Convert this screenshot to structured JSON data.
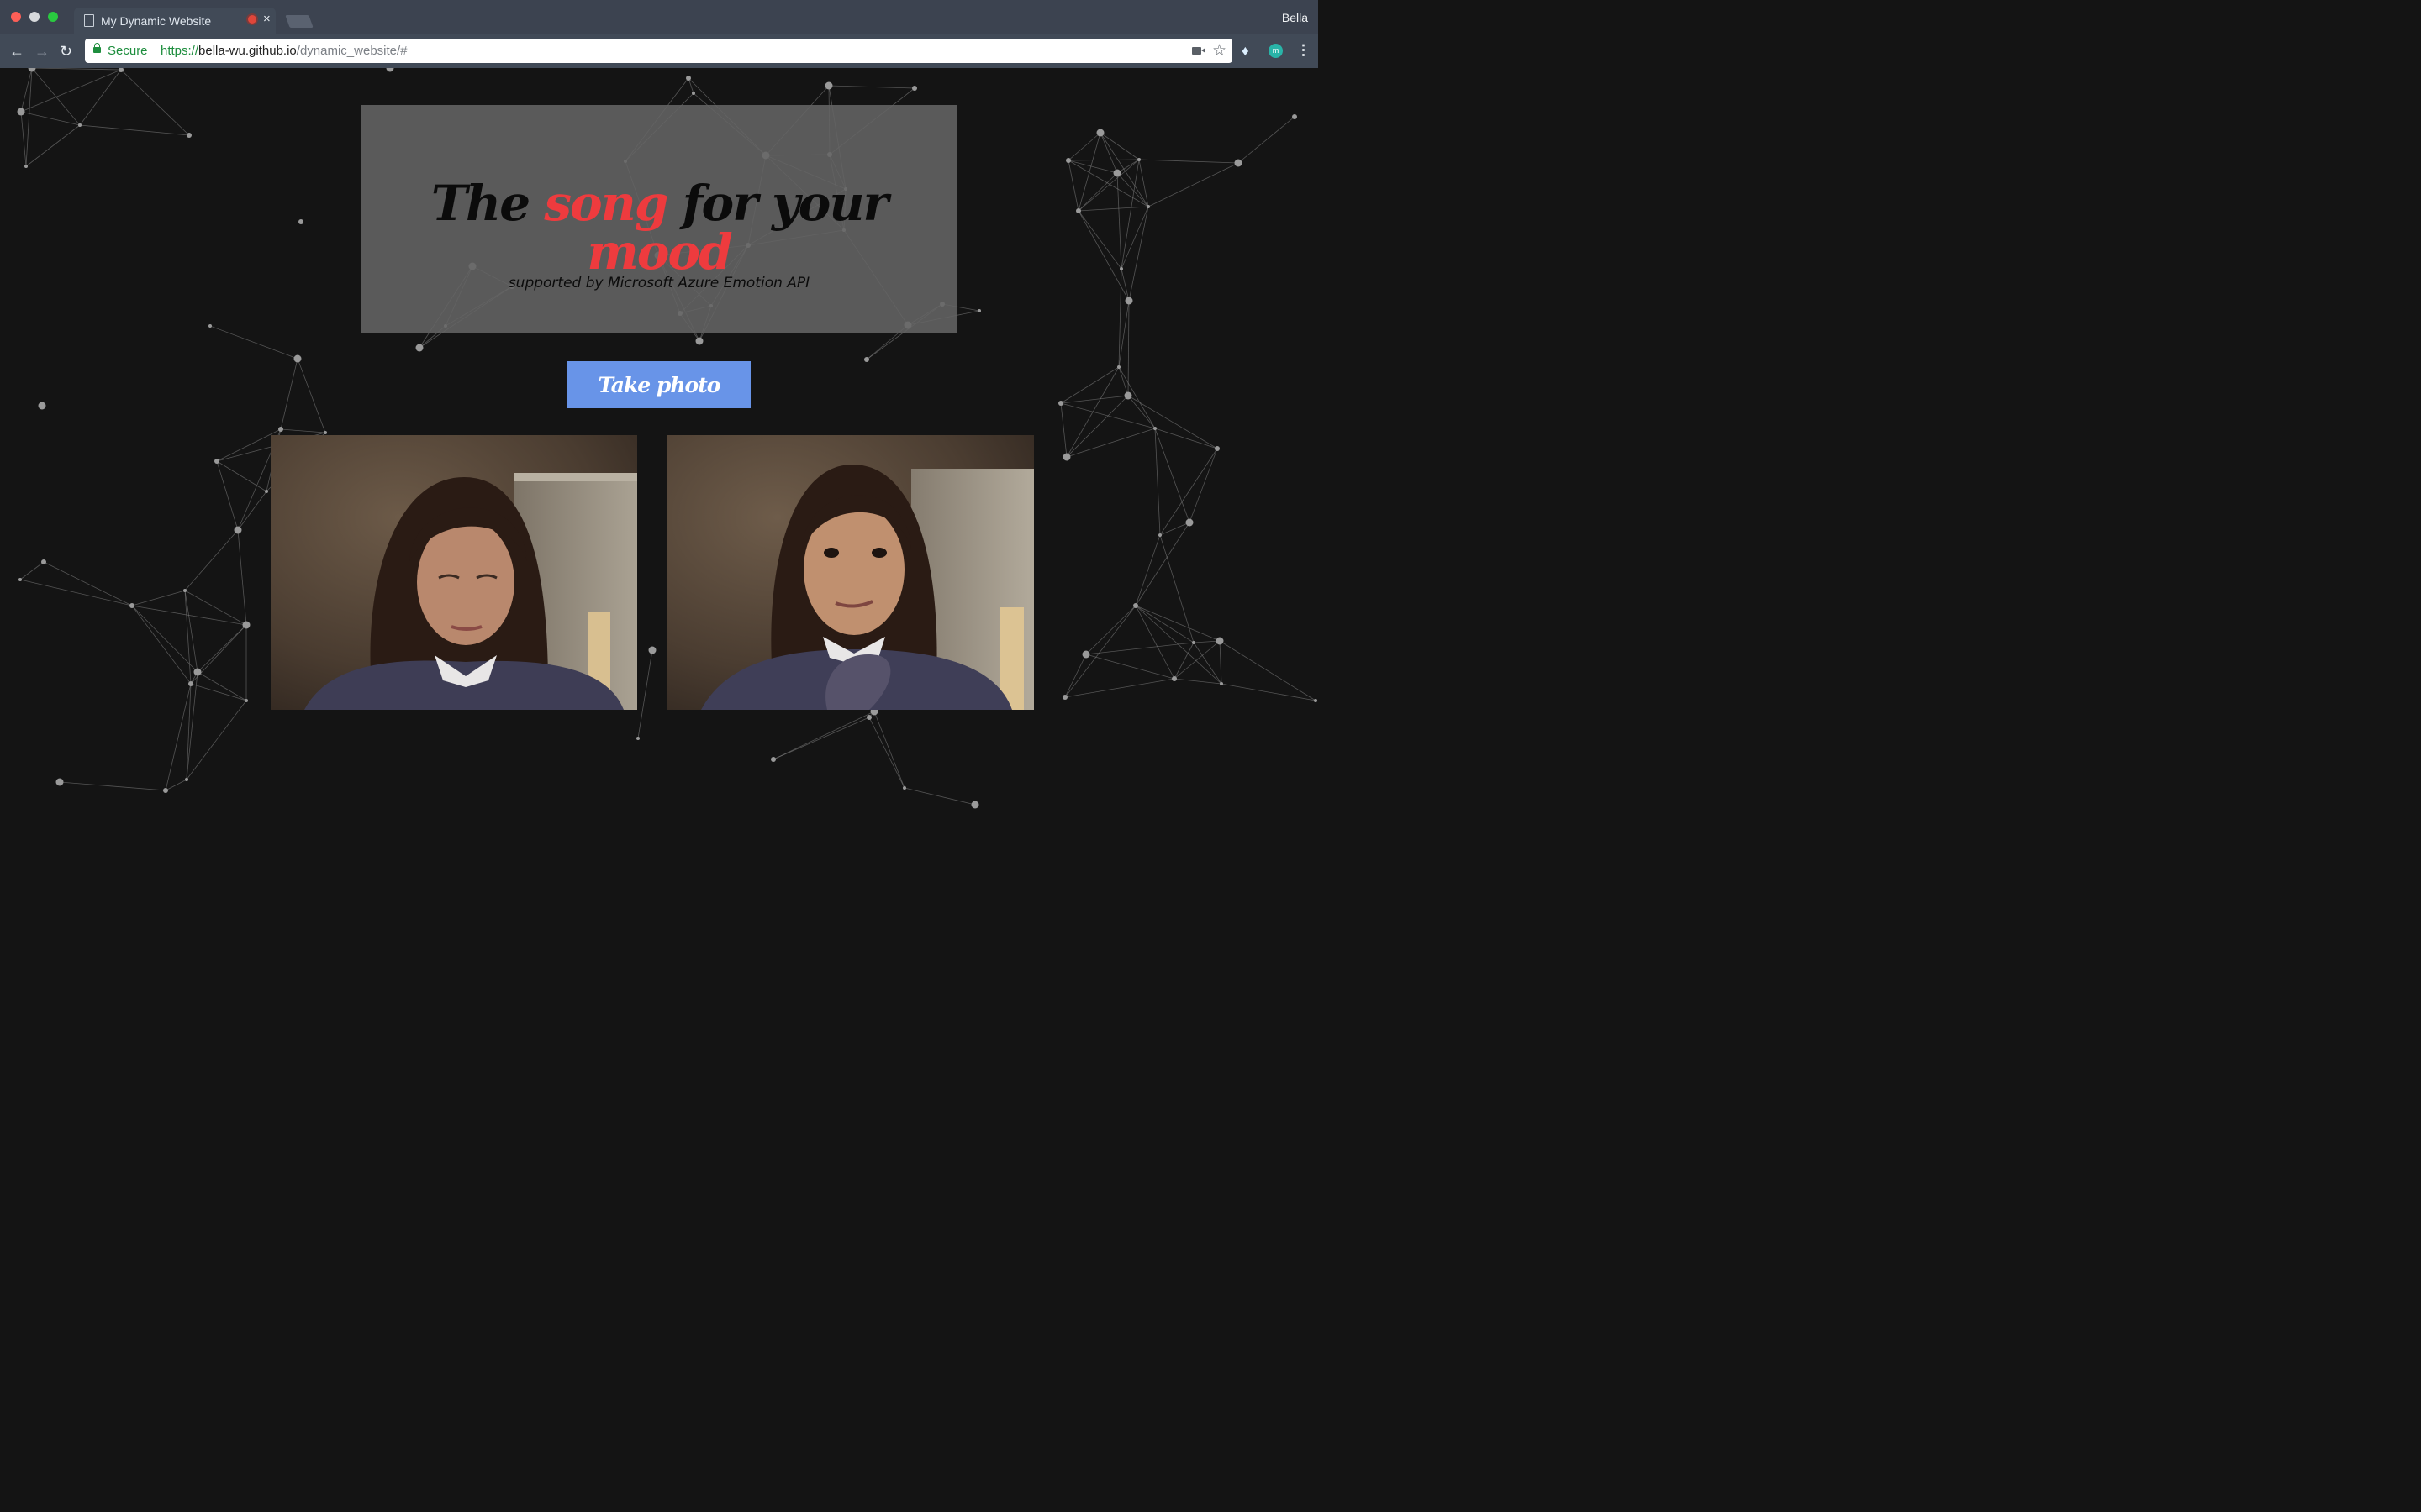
{
  "browser": {
    "tab_title": "My Dynamic Website",
    "tab_close": "×",
    "profile_name": "Bella",
    "secure_label": "Secure",
    "url_scheme": "https://",
    "url_host": "bella-wu.github.io",
    "url_path": "/dynamic_website/#",
    "ext_grammarly_letter": "m"
  },
  "hero": {
    "title_parts": [
      "The ",
      "song",
      " for your ",
      "mood"
    ],
    "subtitle": "supported by Microsoft Azure Emotion API"
  },
  "actions": {
    "take_photo_label": "Take photo"
  },
  "colors": {
    "accent_red": "#ee3b3e",
    "button_blue": "#6894e8",
    "page_bg": "#141414"
  },
  "icons": [
    "page-icon",
    "recording-icon",
    "close-icon",
    "back-icon",
    "forward-icon",
    "reload-icon",
    "lock-icon",
    "camera-icon",
    "star-icon",
    "extension-icon",
    "menu-icon"
  ]
}
